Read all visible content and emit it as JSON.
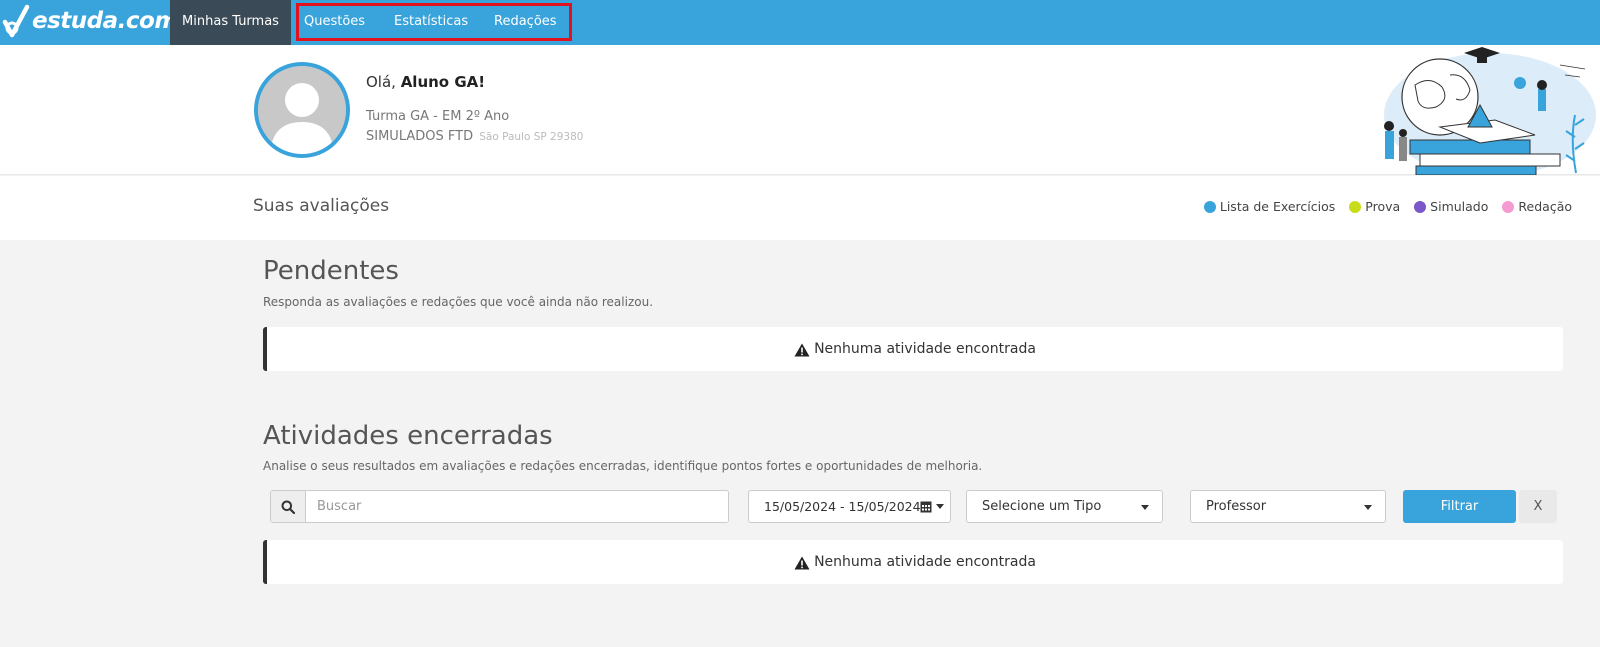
{
  "brand": {
    "name": "estuda.com"
  },
  "nav": {
    "active": "Minhas Turmas",
    "items": [
      "Questões",
      "Estatísticas",
      "Redações"
    ],
    "highlight_color": "#e2131f"
  },
  "profile": {
    "greeting_prefix": "Olá, ",
    "name": "Aluno GA!",
    "turma": "Turma GA - EM 2º Ano",
    "school": "SIMULADOS FTD",
    "location": "São Paulo SP 29380"
  },
  "subheader": {
    "title": "Suas avaliações",
    "legend": [
      {
        "label": "Lista de Exercícios",
        "color": "#39a3dc"
      },
      {
        "label": "Prova",
        "color": "#c8dc1a"
      },
      {
        "label": "Simulado",
        "color": "#7b57c9"
      },
      {
        "label": "Redação",
        "color": "#f59bd2"
      }
    ]
  },
  "pendentes": {
    "title": "Pendentes",
    "description": "Responda as avaliações e redações que você ainda não realizou.",
    "empty": "Nenhuma atividade encontrada"
  },
  "encerradas": {
    "title": "Atividades encerradas",
    "description": "Analise o seus resultados em avaliações e redações encerradas, identifique pontos fortes e oportunidades de melhoria.",
    "empty": "Nenhuma atividade encontrada"
  },
  "filters": {
    "search_placeholder": "Buscar",
    "date_range": "15/05/2024 - 15/05/2024",
    "type_select": "Selecione um Tipo",
    "teacher_select": "Professor",
    "filter_button": "Filtrar",
    "clear_button": "X"
  },
  "colors": {
    "primary": "#39a3dc",
    "nav_active": "#3b4a57"
  }
}
